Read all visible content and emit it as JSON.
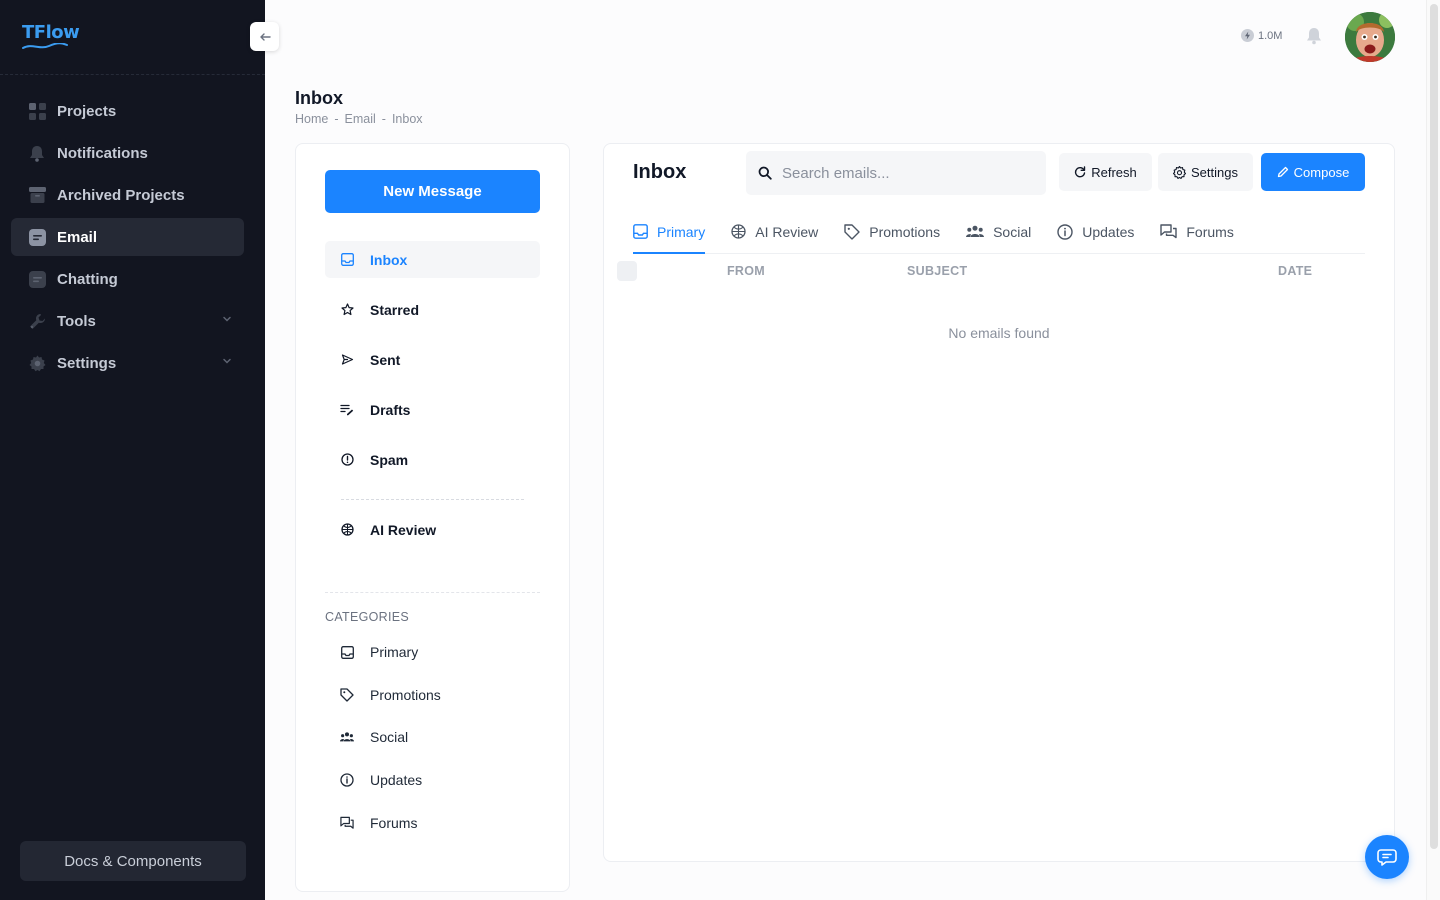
{
  "brand": {
    "name": "TFlow",
    "accent": "#1b84ff",
    "sidebar_bg": "#121520"
  },
  "sidebar": {
    "items": [
      {
        "label": "Projects",
        "icon": "grid-icon",
        "active": false
      },
      {
        "label": "Notifications",
        "icon": "bell-icon",
        "active": false
      },
      {
        "label": "Archived Projects",
        "icon": "archive-icon",
        "active": false
      },
      {
        "label": "Email",
        "icon": "message-icon",
        "active": true
      },
      {
        "label": "Chatting",
        "icon": "chat-icon",
        "active": false
      },
      {
        "label": "Tools",
        "icon": "wrench-icon",
        "active": false,
        "expandable": true
      },
      {
        "label": "Settings",
        "icon": "gear-icon",
        "active": false,
        "expandable": true
      }
    ],
    "docs_button": "Docs & Components"
  },
  "header": {
    "credits": "1.0M"
  },
  "page": {
    "title": "Inbox",
    "breadcrumb": [
      "Home",
      "Email",
      "Inbox"
    ]
  },
  "mail_nav": {
    "new_message": "New Message",
    "folders": [
      {
        "label": "Inbox",
        "icon": "inbox-icon",
        "active": true
      },
      {
        "label": "Starred",
        "icon": "star-icon",
        "active": false
      },
      {
        "label": "Sent",
        "icon": "send-icon",
        "active": false
      },
      {
        "label": "Drafts",
        "icon": "drafts-icon",
        "active": false
      },
      {
        "label": "Spam",
        "icon": "alert-icon",
        "active": false
      }
    ],
    "ai_review": "AI Review",
    "categories_title": "CATEGORIES",
    "categories": [
      {
        "label": "Primary",
        "icon": "inbox-icon"
      },
      {
        "label": "Promotions",
        "icon": "tag-icon"
      },
      {
        "label": "Social",
        "icon": "people-icon"
      },
      {
        "label": "Updates",
        "icon": "info-icon"
      },
      {
        "label": "Forums",
        "icon": "forum-icon"
      }
    ]
  },
  "mail_list": {
    "title": "Inbox",
    "search_placeholder": "Search emails...",
    "refresh": "Refresh",
    "settings": "Settings",
    "compose": "Compose",
    "tabs": [
      {
        "label": "Primary",
        "icon": "inbox-icon",
        "active": true
      },
      {
        "label": "AI Review",
        "icon": "brain-icon",
        "active": false
      },
      {
        "label": "Promotions",
        "icon": "tag-icon",
        "active": false
      },
      {
        "label": "Social",
        "icon": "people-icon",
        "active": false
      },
      {
        "label": "Updates",
        "icon": "info-icon",
        "active": false
      },
      {
        "label": "Forums",
        "icon": "forum-icon",
        "active": false
      }
    ],
    "columns": {
      "from": "FROM",
      "subject": "SUBJECT",
      "date": "DATE"
    },
    "empty": "No emails found"
  }
}
